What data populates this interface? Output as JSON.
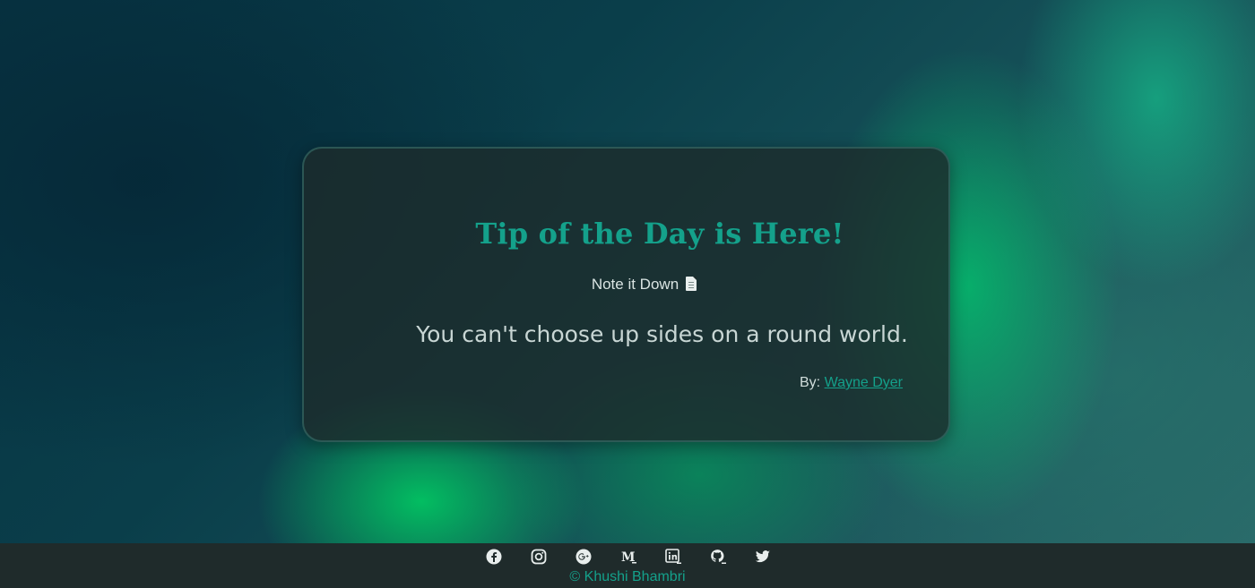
{
  "card": {
    "title": "Tip of the Day is Here!",
    "note_label": "Note it Down",
    "note_icon": "document-icon",
    "quote": "You can't choose up sides on a round world.",
    "author_prefix": "By:",
    "author_name": "Wayne Dyer"
  },
  "footer": {
    "social_icons": [
      "facebook-icon",
      "instagram-icon",
      "google-plus-icon",
      "medium-icon",
      "linkedin-icon",
      "github-icon",
      "twitter-icon"
    ],
    "copyright": "© Khushi Bhambri"
  },
  "colors": {
    "accent": "#14a18b",
    "card_bg": "#1c2c2c",
    "footer_bg": "#1f2b2b",
    "text_light": "#d9e4e2"
  }
}
